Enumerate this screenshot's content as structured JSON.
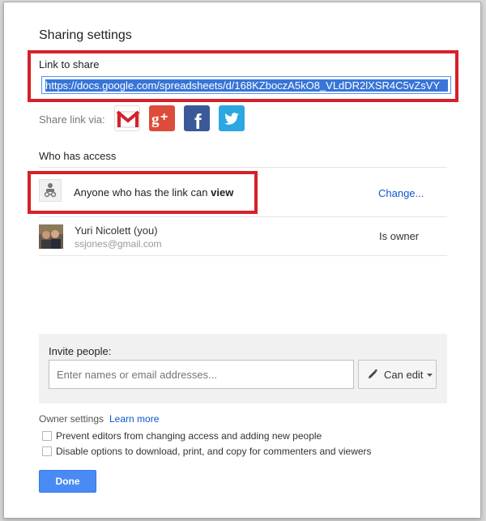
{
  "dialog": {
    "title": "Sharing settings",
    "link_label": "Link to share",
    "link_url": "https://docs.google.com/spreadsheets/d/168KZboczA5kO8_VLdDR2lXSR4C5vZsVY",
    "share_via_label": "Share link via:",
    "share_services": [
      {
        "name": "Gmail",
        "icon": "gmail-icon",
        "color": "#ffffff"
      },
      {
        "name": "Google+",
        "icon": "google-plus-icon",
        "color": "#dd4b39"
      },
      {
        "name": "Facebook",
        "icon": "facebook-icon",
        "color": "#3b5998"
      },
      {
        "name": "Twitter",
        "icon": "twitter-icon",
        "color": "#2ba7e1"
      }
    ],
    "who_has_access_label": "Who has access",
    "access": {
      "text_prefix": "Anyone who has the link can",
      "text_strong": "view",
      "change_label": "Change..."
    },
    "owner_row": {
      "name": "Yuri Nicolett (you)",
      "email": "ssjones@gmail.com",
      "role": "Is owner"
    },
    "invite": {
      "label": "Invite people:",
      "placeholder": "Enter names or email addresses...",
      "permission_label": "Can edit"
    },
    "owner_settings_label": "Owner settings",
    "learn_more_label": "Learn more",
    "options": [
      {
        "label": "Prevent editors from changing access and adding new people",
        "checked": false
      },
      {
        "label": "Disable options to download, print, and copy for commenters and viewers",
        "checked": false
      }
    ],
    "done_label": "Done"
  },
  "colors": {
    "highlight": "#d6202a",
    "link": "#1155cc",
    "primary_button": "#4a8af4",
    "selection": "#3875d7"
  }
}
